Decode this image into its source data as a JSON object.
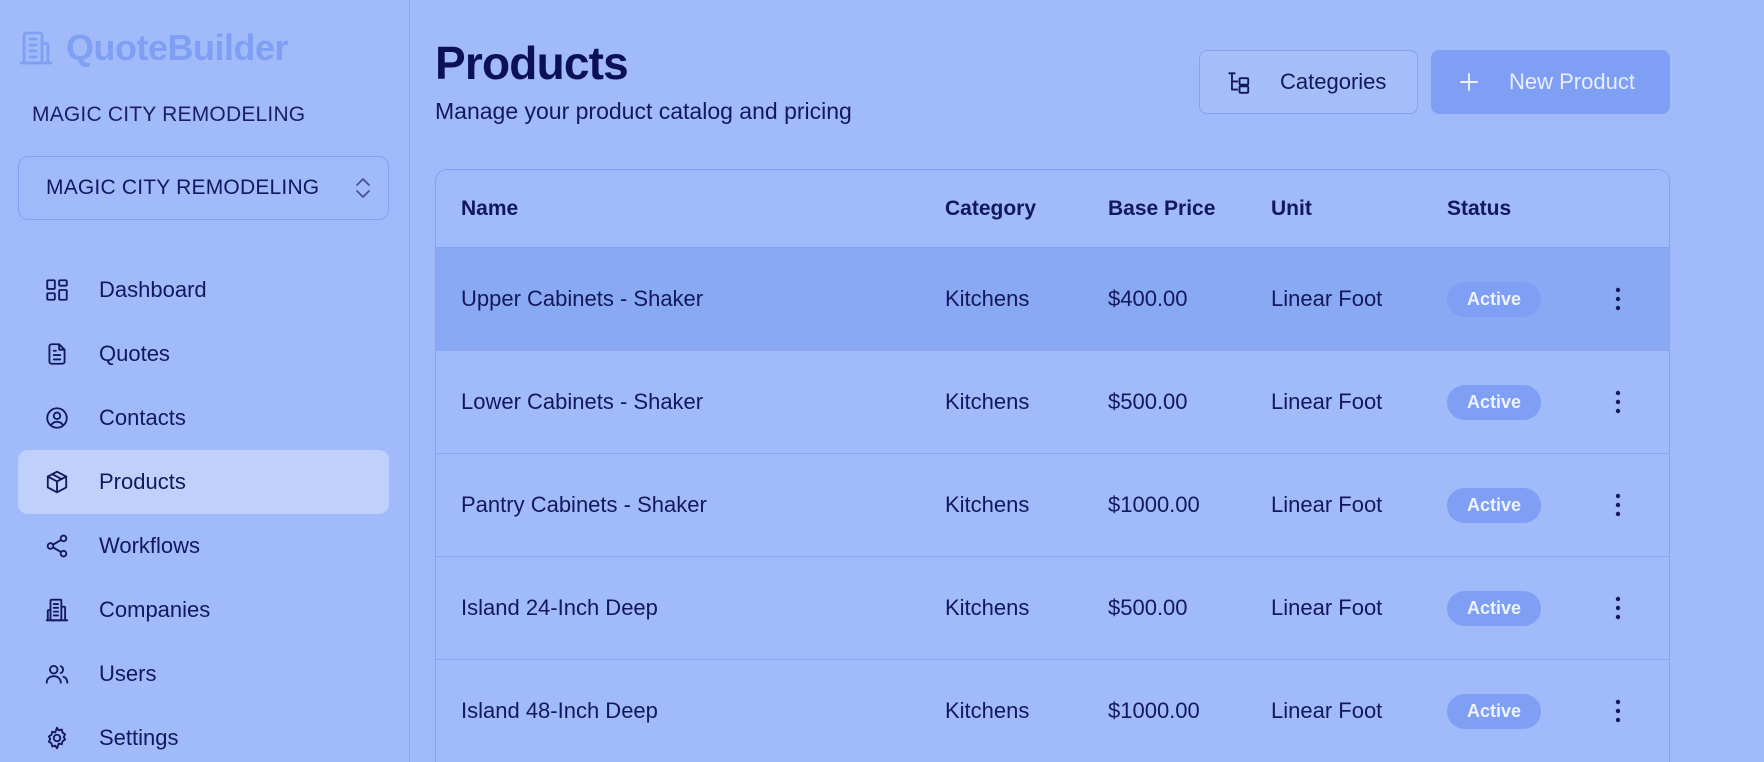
{
  "app": {
    "brand": "QuoteBuilder",
    "org_name": "MAGIC CITY REMODELING",
    "org_select": "MAGIC CITY REMODELING"
  },
  "sidebar": {
    "items": [
      {
        "label": "Dashboard",
        "icon": "dashboard-icon",
        "active": false
      },
      {
        "label": "Quotes",
        "icon": "document-icon",
        "active": false
      },
      {
        "label": "Contacts",
        "icon": "user-circle-icon",
        "active": false
      },
      {
        "label": "Products",
        "icon": "box-icon",
        "active": true
      },
      {
        "label": "Workflows",
        "icon": "share-icon",
        "active": false
      },
      {
        "label": "Companies",
        "icon": "building-icon",
        "active": false
      },
      {
        "label": "Users",
        "icon": "users-icon",
        "active": false
      },
      {
        "label": "Settings",
        "icon": "gear-icon",
        "active": false
      }
    ]
  },
  "page": {
    "title": "Products",
    "subtitle": "Manage your product catalog and pricing",
    "categories_button": "Categories",
    "new_product_button": "New Product"
  },
  "table": {
    "columns": [
      "Name",
      "Category",
      "Base Price",
      "Unit",
      "Status"
    ],
    "rows": [
      {
        "name": "Upper Cabinets - Shaker",
        "category": "Kitchens",
        "price": "$400.00",
        "unit": "Linear Foot",
        "status": "Active"
      },
      {
        "name": "Lower Cabinets - Shaker",
        "category": "Kitchens",
        "price": "$500.00",
        "unit": "Linear Foot",
        "status": "Active"
      },
      {
        "name": "Pantry Cabinets - Shaker",
        "category": "Kitchens",
        "price": "$1000.00",
        "unit": "Linear Foot",
        "status": "Active"
      },
      {
        "name": "Island 24-Inch Deep",
        "category": "Kitchens",
        "price": "$500.00",
        "unit": "Linear Foot",
        "status": "Active"
      },
      {
        "name": "Island 48-Inch Deep",
        "category": "Kitchens",
        "price": "$1000.00",
        "unit": "Linear Foot",
        "status": "Active"
      }
    ]
  },
  "colors": {
    "background": "#a1baf9",
    "accent": "#7f9ff5",
    "text": "#13185a",
    "active_nav": "#bfd0fc"
  }
}
